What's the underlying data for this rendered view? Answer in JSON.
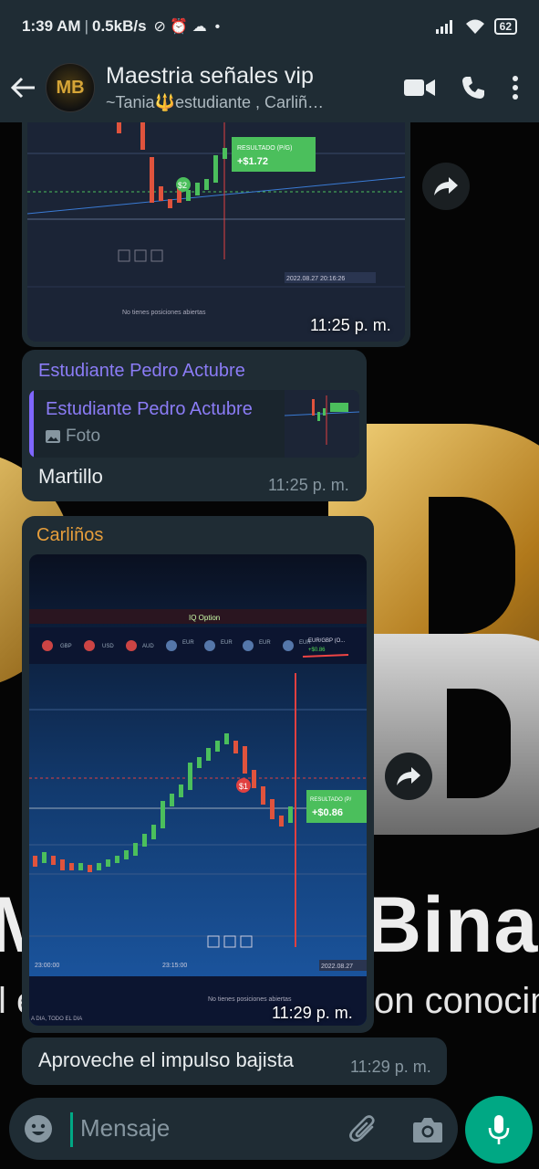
{
  "status_bar": {
    "time": "1:39 AM",
    "net_speed": "0.5kB/s",
    "battery": "62"
  },
  "header": {
    "title": "Maestria señales vip",
    "subtitle": "~Tania🔱estudiante , Carliñ…",
    "avatar_text": "MB"
  },
  "messages": {
    "image1": {
      "time": "11:25 p. m.",
      "chart_label": "RESULTADO (P/G)",
      "chart_value": "+$1.72",
      "chart_amount": "$2",
      "chart_date": "2022.08.27 20:16:26",
      "chart_footer": "No tienes posiciones abiertas"
    },
    "reply": {
      "sender": "Estudiante Pedro Actubre",
      "quoted_sender": "Estudiante Pedro Actubre",
      "quoted_type": "Foto",
      "text": "Martillo",
      "time": "11:25 p. m."
    },
    "image2": {
      "sender": "Carliños",
      "time": "11:29 p. m.",
      "chart_brand": "IQ Option",
      "chart_label": "RESULTADO (P/",
      "chart_value": "+$0.86",
      "chart_amount": "$1",
      "chart_footer": "No tienes posiciones abiertas",
      "chart_pair": "EUR/GBP (O...",
      "chart_pair_value": "+$0.86",
      "tick_left": "23:00:00",
      "tick_mid": "23:15:00",
      "tick_right": "2022.08.27",
      "corner_text": "A DIA, TODO EL DIA"
    },
    "text": {
      "body": "Aproveche el impulso bajista",
      "time": "11:29 p. m."
    }
  },
  "input": {
    "placeholder": "Mensaje"
  },
  "wallpaper": {
    "big": "Binar",
    "sub": "on conocimie",
    "left_big": "Ma",
    "left_sub": "l é"
  },
  "colors": {
    "header_bg": "#1f2c34",
    "accent": "#00a884",
    "sender_purple": "#8b7cf6",
    "sender_orange": "#e79e3b"
  }
}
